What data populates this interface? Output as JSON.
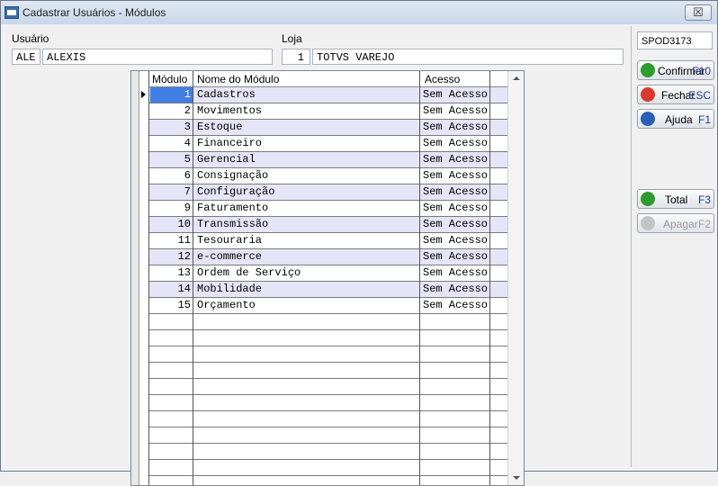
{
  "window": {
    "title": "Cadastrar Usuários - Módulos",
    "close_label": "☒"
  },
  "form": {
    "usuario_label": "Usuário",
    "usuario_code": "ALE",
    "usuario_name": "ALEXIS",
    "loja_label": "Loja",
    "loja_code": "1",
    "loja_name": "TOTVS VAREJO"
  },
  "side": {
    "code": "SPOD3173",
    "buttons": [
      {
        "label": "Confirmar",
        "key": "F10"
      },
      {
        "label": "Fechar",
        "key": "ESC"
      },
      {
        "label": "Ajuda",
        "key": "F1"
      },
      {
        "label": "Total",
        "key": "F3"
      },
      {
        "label": "Apagar",
        "key": "F2"
      }
    ]
  },
  "grid": {
    "columns": [
      "Módulo",
      "Nome do Módulo",
      "Acesso"
    ],
    "rows": [
      {
        "modulo": "1",
        "nome": "Cadastros",
        "acesso": "Sem Acesso"
      },
      {
        "modulo": "2",
        "nome": "Movimentos",
        "acesso": "Sem Acesso"
      },
      {
        "modulo": "3",
        "nome": "Estoque",
        "acesso": "Sem Acesso"
      },
      {
        "modulo": "4",
        "nome": "Financeiro",
        "acesso": "Sem Acesso"
      },
      {
        "modulo": "5",
        "nome": "Gerencial",
        "acesso": "Sem Acesso"
      },
      {
        "modulo": "6",
        "nome": "Consignação",
        "acesso": "Sem Acesso"
      },
      {
        "modulo": "7",
        "nome": "Configuração",
        "acesso": "Sem Acesso"
      },
      {
        "modulo": "9",
        "nome": "Faturamento",
        "acesso": "Sem Acesso"
      },
      {
        "modulo": "10",
        "nome": "Transmissão",
        "acesso": "Sem Acesso"
      },
      {
        "modulo": "11",
        "nome": "Tesouraria",
        "acesso": "Sem Acesso"
      },
      {
        "modulo": "12",
        "nome": "e-commerce",
        "acesso": "Sem Acesso"
      },
      {
        "modulo": "13",
        "nome": "Ordem de Serviço",
        "acesso": "Sem Acesso"
      },
      {
        "modulo": "14",
        "nome": "Mobilidade",
        "acesso": "Sem Acesso"
      },
      {
        "modulo": "15",
        "nome": "Orçamento",
        "acesso": "Sem Acesso"
      }
    ]
  },
  "colors": {
    "selection": "#2f72e0",
    "alt_row": "#e5e5f7",
    "confirm_icon": "#2e9b2e",
    "close_icon": "#d93a2b",
    "help_icon": "#2a5fb8"
  }
}
